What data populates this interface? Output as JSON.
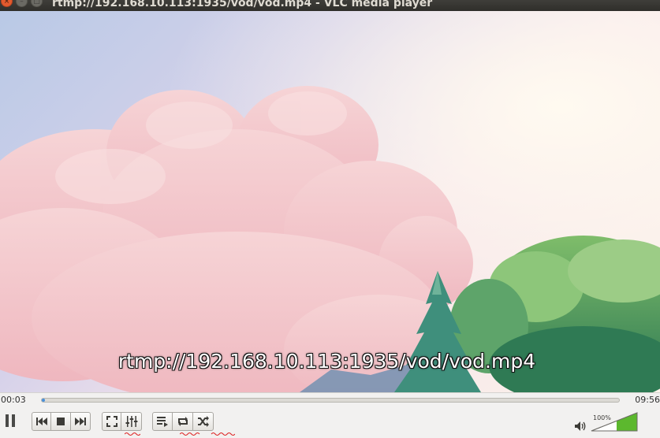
{
  "window": {
    "title": "rtmp://192.168.10.113:1935/vod/vod.mp4 - VLC media player",
    "close_glyph": "×",
    "minimize_glyph": "–",
    "maximize_glyph": "□"
  },
  "video": {
    "subtitle": "rtmp://192.168.10.113:1935/vod/vod.mp4"
  },
  "playback": {
    "elapsed": "00:03",
    "total": "09:56",
    "progress_fraction": 0.005
  },
  "controls": {
    "buttons": [
      {
        "name": "pause-button",
        "icon": "pause-icon"
      },
      {
        "name": "previous-button",
        "icon": "skip-previous-icon"
      },
      {
        "name": "stop-button",
        "icon": "stop-icon"
      },
      {
        "name": "next-button",
        "icon": "skip-next-icon"
      },
      {
        "name": "fullscreen-button",
        "icon": "fullscreen-icon"
      },
      {
        "name": "extended-settings-button",
        "icon": "equalizer-icon"
      },
      {
        "name": "playlist-button",
        "icon": "playlist-icon"
      },
      {
        "name": "loop-button",
        "icon": "loop-icon"
      },
      {
        "name": "shuffle-button",
        "icon": "shuffle-icon"
      }
    ]
  },
  "volume": {
    "label": "100%",
    "level": 1.0,
    "icon": "speaker-icon",
    "colors": {
      "fill": "#5cb82e",
      "empty": "#ffffff"
    }
  }
}
